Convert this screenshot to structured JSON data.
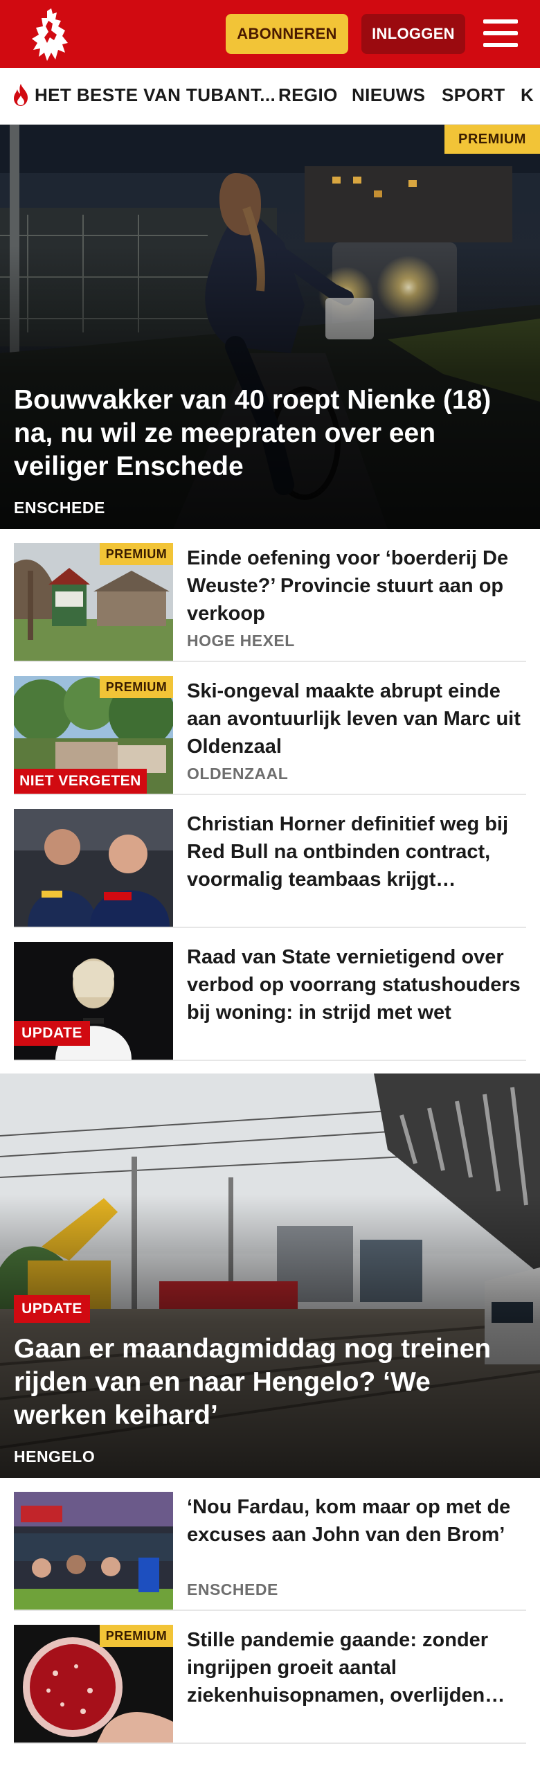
{
  "header": {
    "subscribe_label": "ABONNEREN",
    "login_label": "INLOGGEN",
    "brand_color": "#d10a11",
    "accent_color": "#f2c437"
  },
  "nav": {
    "items": [
      "HET BESTE VAN TUBANT...",
      "REGIO",
      "NIEUWS",
      "SPORT",
      "K"
    ]
  },
  "hero1": {
    "badge": "PREMIUM",
    "title": "Bouwvakker van 40 roept Nienke (18) na, nu wil ze meepraten over een veiliger Enschede",
    "location": "ENSCHEDE"
  },
  "articles1": [
    {
      "badge": "PREMIUM",
      "title": "Einde oefening voor ‘boerderij De Weuste?’ Provincie stuurt aan op verkoop",
      "location": "HOGE HEXEL"
    },
    {
      "badge": "PREMIUM",
      "label": "NIET VERGETEN",
      "title": "Ski-ongeval maakte abrupt einde aan avontuurlijk leven van Marc uit Oldenzaal",
      "location": "OLDENZAAL"
    },
    {
      "title": "Christian Horner definitief weg bij Red Bull na ontbinden contract, voormalig teambaas krijgt miljoenen mee",
      "location": ""
    },
    {
      "label": "UPDATE",
      "title": "Raad van State vernietigend over verbod op voorrang statushou­ders bij woning: in strijd met wet",
      "location": ""
    }
  ],
  "hero2": {
    "label": "UPDATE",
    "title": "Gaan er maandagmiddag nog treinen rijden van en naar Hengelo? ‘We werken keihard’",
    "location": "HENGELO"
  },
  "articles2": [
    {
      "title": "‘Nou Fardau, kom maar op met de excuses aan John van den Brom’",
      "location": "ENSCHEDE"
    },
    {
      "badge": "PREMIUM",
      "title": "Stille pandemie gaande: zonder ingrijpen groeit aantal ziekenhuisopnamen, overlijden stijgt",
      "location": ""
    }
  ]
}
